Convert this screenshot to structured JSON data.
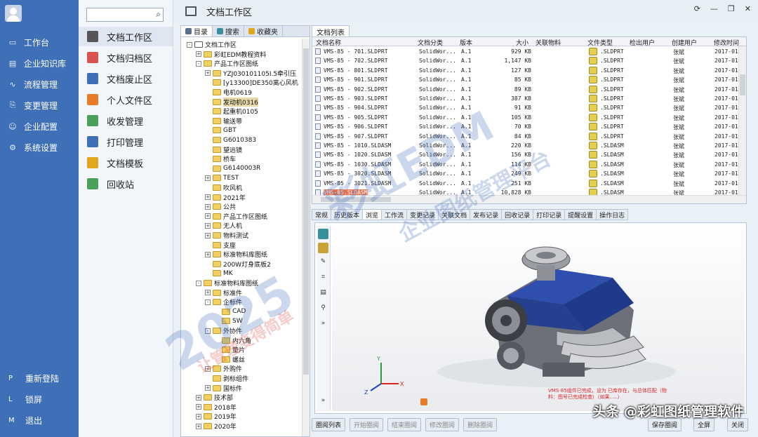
{
  "nav": {
    "items": [
      {
        "icon": "monitor-icon",
        "label": "工作台"
      },
      {
        "icon": "library-icon",
        "label": "企业知识库"
      },
      {
        "icon": "flow-icon",
        "label": "流程管理"
      },
      {
        "icon": "change-icon",
        "label": "变更管理"
      },
      {
        "icon": "users-icon",
        "label": "企业配置"
      },
      {
        "icon": "gear-icon",
        "label": "系统设置"
      }
    ],
    "bottom": [
      {
        "key": "P",
        "label": "重新登陆"
      },
      {
        "key": "L",
        "label": "锁屏"
      },
      {
        "key": "M",
        "label": "退出"
      }
    ]
  },
  "submenu": {
    "search_placeholder": "",
    "items": [
      {
        "label": "文档工作区",
        "color": "#555555",
        "active": true
      },
      {
        "label": "文档归档区",
        "color": "#d9534f"
      },
      {
        "label": "文档废止区",
        "color": "#3f6fb6"
      },
      {
        "label": "个人文件区",
        "color": "#e67c2a"
      },
      {
        "label": "收发管理",
        "color": "#4aa05a"
      },
      {
        "label": "打印管理",
        "color": "#3f6fb6"
      },
      {
        "label": "文档模板",
        "color": "#e0a81c"
      },
      {
        "label": "回收站",
        "color": "#4aa05a"
      }
    ]
  },
  "window": {
    "title": "文档工作区",
    "controls": [
      "⟳",
      "—",
      "❐",
      "✕"
    ]
  },
  "tree_tabs": [
    "目录",
    "搜索",
    "收藏夹"
  ],
  "tree": [
    {
      "d": 0,
      "pm": "-",
      "label": "文档工作区"
    },
    {
      "d": 1,
      "pm": "+",
      "label": "彩虹EDM教程资料"
    },
    {
      "d": 1,
      "pm": "-",
      "label": "产品工作区图纸"
    },
    {
      "d": 2,
      "pm": "+",
      "label": "YZJ030101105Ⅰ.5牵引压"
    },
    {
      "d": 2,
      "pm": "",
      "label": "[y13300]DE350离心风机"
    },
    {
      "d": 2,
      "pm": "",
      "label": "电机0619"
    },
    {
      "d": 2,
      "pm": "",
      "label": "发动机0316",
      "sel": true
    },
    {
      "d": 2,
      "pm": "",
      "label": "起重机0105"
    },
    {
      "d": 2,
      "pm": "",
      "label": "输送带"
    },
    {
      "d": 2,
      "pm": "",
      "label": "GBT"
    },
    {
      "d": 2,
      "pm": "",
      "label": "G6010383"
    },
    {
      "d": 2,
      "pm": "",
      "label": "望远镜"
    },
    {
      "d": 2,
      "pm": "",
      "label": "桥车"
    },
    {
      "d": 2,
      "pm": "",
      "label": "G6140003R"
    },
    {
      "d": 2,
      "pm": "+",
      "label": "TEST"
    },
    {
      "d": 2,
      "pm": "",
      "label": "吹风机"
    },
    {
      "d": 2,
      "pm": "+",
      "label": "2021年"
    },
    {
      "d": 2,
      "pm": "+",
      "label": "公共"
    },
    {
      "d": 2,
      "pm": "+",
      "label": "产品工作区图纸"
    },
    {
      "d": 2,
      "pm": "+",
      "label": "无人机"
    },
    {
      "d": 2,
      "pm": "+",
      "label": "物料测试"
    },
    {
      "d": 2,
      "pm": "",
      "label": "支座"
    },
    {
      "d": 2,
      "pm": "+",
      "label": "标准物料库图纸"
    },
    {
      "d": 2,
      "pm": "",
      "label": "200W灯身底板2"
    },
    {
      "d": 2,
      "pm": "",
      "label": "MK"
    },
    {
      "d": 1,
      "pm": "-",
      "label": "标准物料库图纸"
    },
    {
      "d": 2,
      "pm": "+",
      "label": "标准件"
    },
    {
      "d": 2,
      "pm": "-",
      "label": "企标件"
    },
    {
      "d": 3,
      "pm": "",
      "label": "CAD"
    },
    {
      "d": 3,
      "pm": "",
      "label": "SW"
    },
    {
      "d": 2,
      "pm": "-",
      "label": "外协件"
    },
    {
      "d": 3,
      "pm": "",
      "label": "内六角"
    },
    {
      "d": 3,
      "pm": "",
      "label": "垫片"
    },
    {
      "d": 3,
      "pm": "",
      "label": "螺丝"
    },
    {
      "d": 2,
      "pm": "+",
      "label": "外购件"
    },
    {
      "d": 2,
      "pm": "",
      "label": "剥标组件"
    },
    {
      "d": 2,
      "pm": "+",
      "label": "国标件"
    },
    {
      "d": 1,
      "pm": "+",
      "label": "技术部"
    },
    {
      "d": 1,
      "pm": "+",
      "label": "2018年"
    },
    {
      "d": 1,
      "pm": "+",
      "label": "2019年"
    },
    {
      "d": 1,
      "pm": "+",
      "label": "2020年"
    }
  ],
  "doc_tab": "文档列表",
  "grid": {
    "headers": [
      "文档名称",
      "文档分类",
      "版本",
      "大小",
      "关联物料",
      "文件类型",
      "检出用户",
      "创建用户",
      "修改时间"
    ],
    "rows": [
      {
        "name": "VMS-85 - 701.SLDPRT",
        "cat": "SolidWor...",
        "ver": "A.1",
        "size": "929 KB",
        "type": ".SLDPRT",
        "user": "张斌",
        "time": "2017-01-"
      },
      {
        "name": "VMS-85 - 702.SLDPRT",
        "cat": "SolidWor...",
        "ver": "A.1",
        "size": "1,147 KB",
        "type": ".SLDPRT",
        "user": "张斌",
        "time": "2017-01-"
      },
      {
        "name": "VMS-85 - 801.SLDPRT",
        "cat": "SolidWor...",
        "ver": "A.1",
        "size": "127 KB",
        "type": ".SLDPRT",
        "user": "张斌",
        "time": "2017-01-"
      },
      {
        "name": "VMS-85 - 901.SLDPRT",
        "cat": "SolidWor...",
        "ver": "A.1",
        "size": "85 KB",
        "type": ".SLDPRT",
        "user": "张斌",
        "time": "2017-01-"
      },
      {
        "name": "VMS-85 - 902.SLDPRT",
        "cat": "SolidWor...",
        "ver": "A.1",
        "size": "89 KB",
        "type": ".SLDPRT",
        "user": "张斌",
        "time": "2017-01-"
      },
      {
        "name": "VMS-85 - 903.SLDPRT",
        "cat": "SolidWor...",
        "ver": "A.1",
        "size": "387 KB",
        "type": ".SLDPRT",
        "user": "张斌",
        "time": "2017-01-"
      },
      {
        "name": "VMS-85 - 904.SLDPRT",
        "cat": "SolidWor...",
        "ver": "A.1",
        "size": "91 KB",
        "type": ".SLDPRT",
        "user": "张斌",
        "time": "2017-01-"
      },
      {
        "name": "VMS-85 - 905.SLDPRT",
        "cat": "SolidWor...",
        "ver": "A.1",
        "size": "105 KB",
        "type": ".SLDPRT",
        "user": "张斌",
        "time": "2017-01-"
      },
      {
        "name": "VMS-85 - 906.SLDPRT",
        "cat": "SolidWor...",
        "ver": "A.1",
        "size": "70 KB",
        "type": ".SLDPRT",
        "user": "张斌",
        "time": "2017-01-"
      },
      {
        "name": "VMS-85 - 907.SLDPRT",
        "cat": "SolidWor...",
        "ver": "A.1",
        "size": "84 KB",
        "type": ".SLDPRT",
        "user": "张斌",
        "time": "2017-01-"
      },
      {
        "name": "VMS-85 - 1010.SLDASM",
        "cat": "SolidWor...",
        "ver": "A.1",
        "size": "220 KB",
        "type": ".SLDASM",
        "user": "张斌",
        "time": "2017-01-"
      },
      {
        "name": "VMS-85 - 1020.SLDASM",
        "cat": "SolidWor...",
        "ver": "A.1",
        "size": "156 KB",
        "type": ".SLDASM",
        "user": "张斌",
        "time": "2017-01-"
      },
      {
        "name": "VMS-85 - 1030.SLDASM",
        "cat": "SolidWor...",
        "ver": "A.1",
        "size": "114 KB",
        "type": ".SLDASM",
        "user": "张斌",
        "time": "2017-01-"
      },
      {
        "name": "VMS-85 - 3020.SLDASM",
        "cat": "SolidWor...",
        "ver": "A.1",
        "size": "249 KB",
        "type": ".SLDASM",
        "user": "张斌",
        "time": "2017-01-"
      },
      {
        "name": "VMS-85 - 3021.SLDASM",
        "cat": "SolidWor...",
        "ver": "A.1",
        "size": "251 KB",
        "type": ".SLDASM",
        "user": "张斌",
        "time": "2017-01-"
      },
      {
        "name": "VMS-85.SLDASM",
        "cat": "SolidWor...",
        "ver": "A.1",
        "size": "10,828 KB",
        "type": ".SLDASM",
        "user": "张斌",
        "time": "2017-01-",
        "sel": true
      }
    ]
  },
  "detail_tabs": [
    "常规",
    "历史版本",
    "浏览",
    "工作流",
    "变更记录",
    "关联文档",
    "发布记录",
    "回收记录",
    "打印记录",
    "提醒设置",
    "操作日志"
  ],
  "detail_active": 2,
  "viewer_note": "VMS-85组件已完成，设为 已库存在，与总体匹配（物料：图号已完成检查）（如果.....）",
  "bottom_buttons": {
    "left": [
      "圈阅列表",
      "开始圈阅",
      "结束圈阅",
      "修改圈阅",
      "删除圈阅"
    ],
    "right": [
      "保存圈阅",
      "全屏",
      "关闭"
    ]
  },
  "watermark": {
    "brand": "彩虹EDM",
    "sub": "企业图纸管理平台",
    "year": "2025",
    "slogan": "让管理变得简单"
  },
  "caption": "头条 @彩虹图纸管理软件",
  "colors": {
    "nav_bg": "#3f6fb6",
    "accent": "#3f6fb6",
    "selected_row": "#e8704a"
  }
}
